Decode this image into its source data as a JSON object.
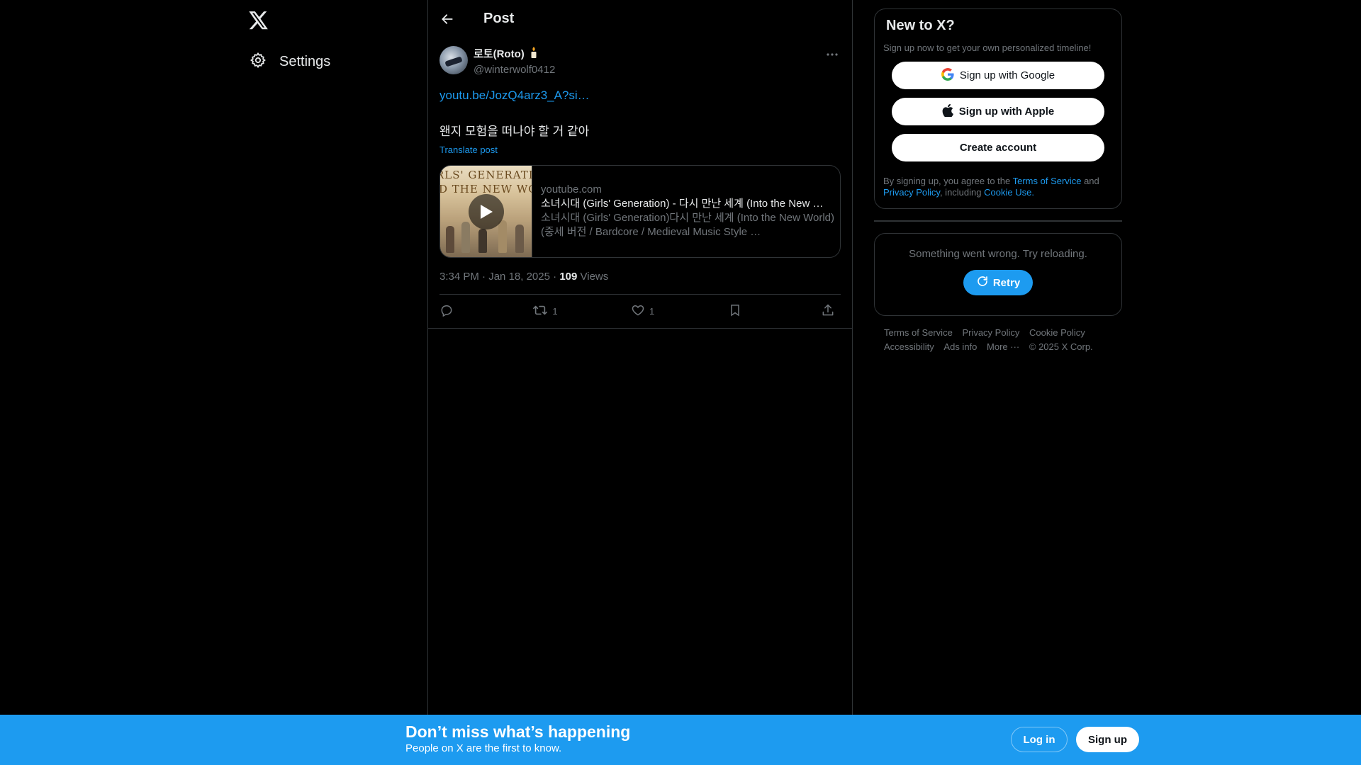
{
  "nav": {
    "settings_label": "Settings"
  },
  "header": {
    "title": "Post"
  },
  "post": {
    "display_name": "로토(Roto)",
    "handle": "@winterwolf0412",
    "link_text": "youtu.be/JozQ4arz3_A?si…",
    "text": "왠지 모험을 떠나야 할 거 같아",
    "translate_label": "Translate post",
    "card": {
      "thumb_text_1": "RLS' GENERATIO",
      "thumb_text_2": "D THE NEW WO",
      "domain": "youtube.com",
      "title": "소녀시대 (Girls' Generation) - 다시 만난 세계 (Into the New …",
      "description": "소녀시대 (Girls' Generation)다시 만난 세계 (Into the New World) (중세 버전 / Bardcore / Medieval Music Style …"
    },
    "time": "3:34 PM",
    "dot": "·",
    "date": "Jan 18, 2025",
    "views_count": "109",
    "views_label": "Views",
    "actions": {
      "reply_count": "",
      "repost_count": "1",
      "like_count": "1"
    }
  },
  "signup": {
    "title": "New to X?",
    "subtitle": "Sign up now to get your own personalized timeline!",
    "google_label": "Sign up with Google",
    "apple_label": "Sign up with Apple",
    "create_label": "Create account",
    "terms_prefix": "By signing up, you agree to the",
    "terms_link": "Terms of Service",
    "terms_and": "and",
    "privacy_link": "Privacy Policy",
    "terms_including": ", including",
    "cookie_link": "Cookie Use."
  },
  "error": {
    "message": "Something went wrong. Try reloading.",
    "retry_label": "Retry"
  },
  "footer": {
    "links": [
      "Terms of Service",
      "Privacy Policy",
      "Cookie Policy",
      "Accessibility",
      "Ads info",
      "More ···"
    ],
    "copyright": "© 2025 X Corp."
  },
  "bottom_bar": {
    "title": "Don’t miss what’s happening",
    "subtitle": "People on X are the first to know.",
    "login_label": "Log in",
    "signup_label": "Sign up"
  },
  "colors": {
    "accent": "#1d9bf0",
    "background": "#000000",
    "border": "#2f3336",
    "muted": "#71767b"
  }
}
